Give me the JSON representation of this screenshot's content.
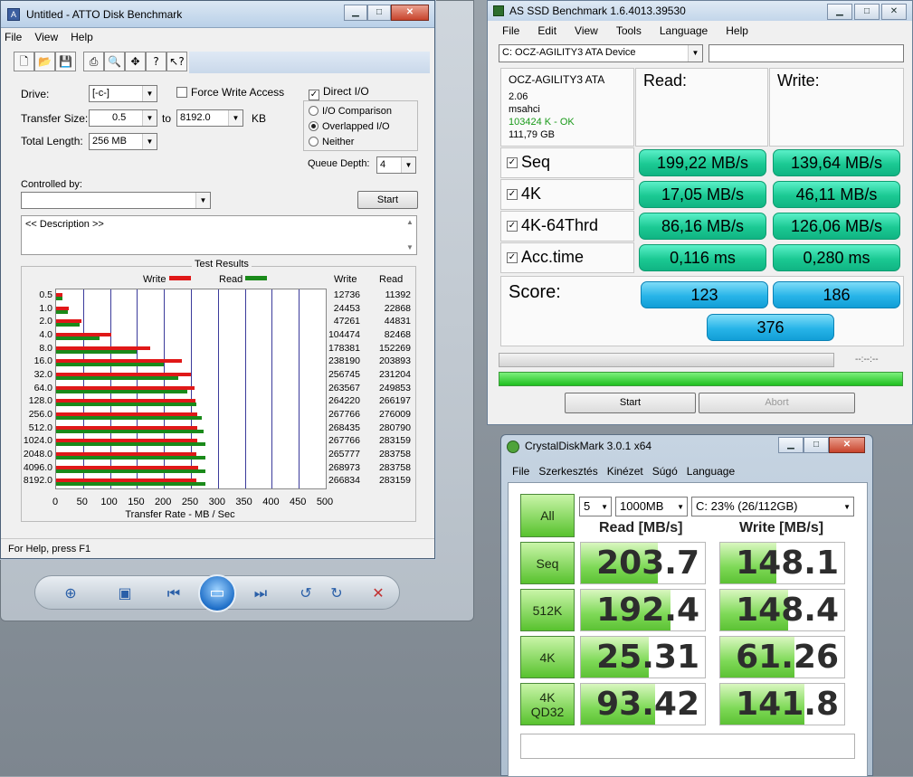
{
  "atto": {
    "title": "Untitled - ATTO Disk Benchmark",
    "menu": [
      "File",
      "View",
      "Help"
    ],
    "drive_label": "Drive:",
    "drive_value": "[-c-]",
    "force_write_label": "Force Write Access",
    "direct_io_label": "Direct I/O",
    "transfer_size_label": "Transfer Size:",
    "transfer_from": "0.5",
    "to_label": "to",
    "transfer_to": "8192.0",
    "kb_label": "KB",
    "total_length_label": "Total Length:",
    "total_length_value": "256 MB",
    "io_comparison_label": "I/O Comparison",
    "overlapped_io_label": "Overlapped I/O",
    "neither_label": "Neither",
    "queue_depth_label": "Queue Depth:",
    "queue_depth_value": "4",
    "controlled_by_label": "Controlled by:",
    "start_label": "Start",
    "description": "<< Description >>",
    "test_results_label": "Test Results",
    "legend_write": "Write",
    "legend_read": "Read",
    "col_write": "Write",
    "col_read": "Read",
    "xaxis_label": "Transfer Rate - MB / Sec",
    "status": "For Help, press F1",
    "colors": {
      "write": "#e01818",
      "read": "#1a8a1a"
    }
  },
  "chart_data": {
    "type": "bar",
    "title": "Test Results",
    "xlabel": "Transfer Rate - MB / Sec",
    "categories": [
      "0.5",
      "1.0",
      "2.0",
      "4.0",
      "8.0",
      "16.0",
      "32.0",
      "64.0",
      "128.0",
      "256.0",
      "512.0",
      "1024.0",
      "2048.0",
      "4096.0",
      "8192.0"
    ],
    "series": [
      {
        "name": "Write",
        "values": [
          12736,
          24453,
          47261,
          104474,
          178381,
          238190,
          256745,
          263567,
          264220,
          267766,
          268435,
          267766,
          265777,
          268973,
          266834
        ]
      },
      {
        "name": "Read",
        "values": [
          11392,
          22868,
          44831,
          82468,
          152269,
          203893,
          231204,
          249853,
          266197,
          276009,
          280790,
          283159,
          283758,
          283758,
          283159
        ]
      }
    ],
    "xticks": [
      "0",
      "50",
      "100",
      "150",
      "200",
      "250",
      "300",
      "350",
      "400",
      "450",
      "500"
    ],
    "xlim": [
      0,
      500
    ]
  },
  "asssd": {
    "title": "AS SSD Benchmark 1.6.4013.39530",
    "menu": [
      "File",
      "Edit",
      "View",
      "Tools",
      "Language",
      "Help"
    ],
    "device": "C: OCZ-AGILITY3 ATA Device",
    "info": {
      "model": "OCZ-AGILITY3 ATA",
      "fw": "2.06",
      "driver": "msahci",
      "align": "103424 K - OK",
      "size": "111,79 GB"
    },
    "read_header": "Read:",
    "write_header": "Write:",
    "rows": [
      {
        "label": "Seq",
        "read": "199,22 MB/s",
        "write": "139,64 MB/s"
      },
      {
        "label": "4K",
        "read": "17,05 MB/s",
        "write": "46,11 MB/s"
      },
      {
        "label": "4K-64Thrd",
        "read": "86,16 MB/s",
        "write": "126,06 MB/s"
      },
      {
        "label": "Acc.time",
        "read": "0,116 ms",
        "write": "0,280 ms"
      }
    ],
    "score_label": "Score:",
    "score_read": "123",
    "score_write": "186",
    "score_total": "376",
    "time": "--:--:--",
    "start_label": "Start",
    "abort_label": "Abort"
  },
  "cdm": {
    "title": "CrystalDiskMark 3.0.1 x64",
    "menu": [
      "File",
      "Szerkesztés",
      "Kinézet",
      "Súgó",
      "Language"
    ],
    "all_label": "All",
    "runs": "5",
    "size": "1000MB",
    "drive": "C: 23% (26/112GB)",
    "read_header": "Read [MB/s]",
    "write_header": "Write [MB/s]",
    "rows": [
      {
        "label": "Seq",
        "read": "203.7",
        "write": "148.1",
        "read_fill": 0.62,
        "write_fill": 0.45
      },
      {
        "label": "512K",
        "read": "192.4",
        "write": "148.4",
        "read_fill": 0.72,
        "write_fill": 0.55
      },
      {
        "label": "4K",
        "read": "25.31",
        "write": "61.26",
        "read_fill": 0.55,
        "write_fill": 0.6
      },
      {
        "label": "4K\nQD32",
        "read": "93.42",
        "write": "141.8",
        "read_fill": 0.6,
        "write_fill": 0.68
      }
    ]
  }
}
